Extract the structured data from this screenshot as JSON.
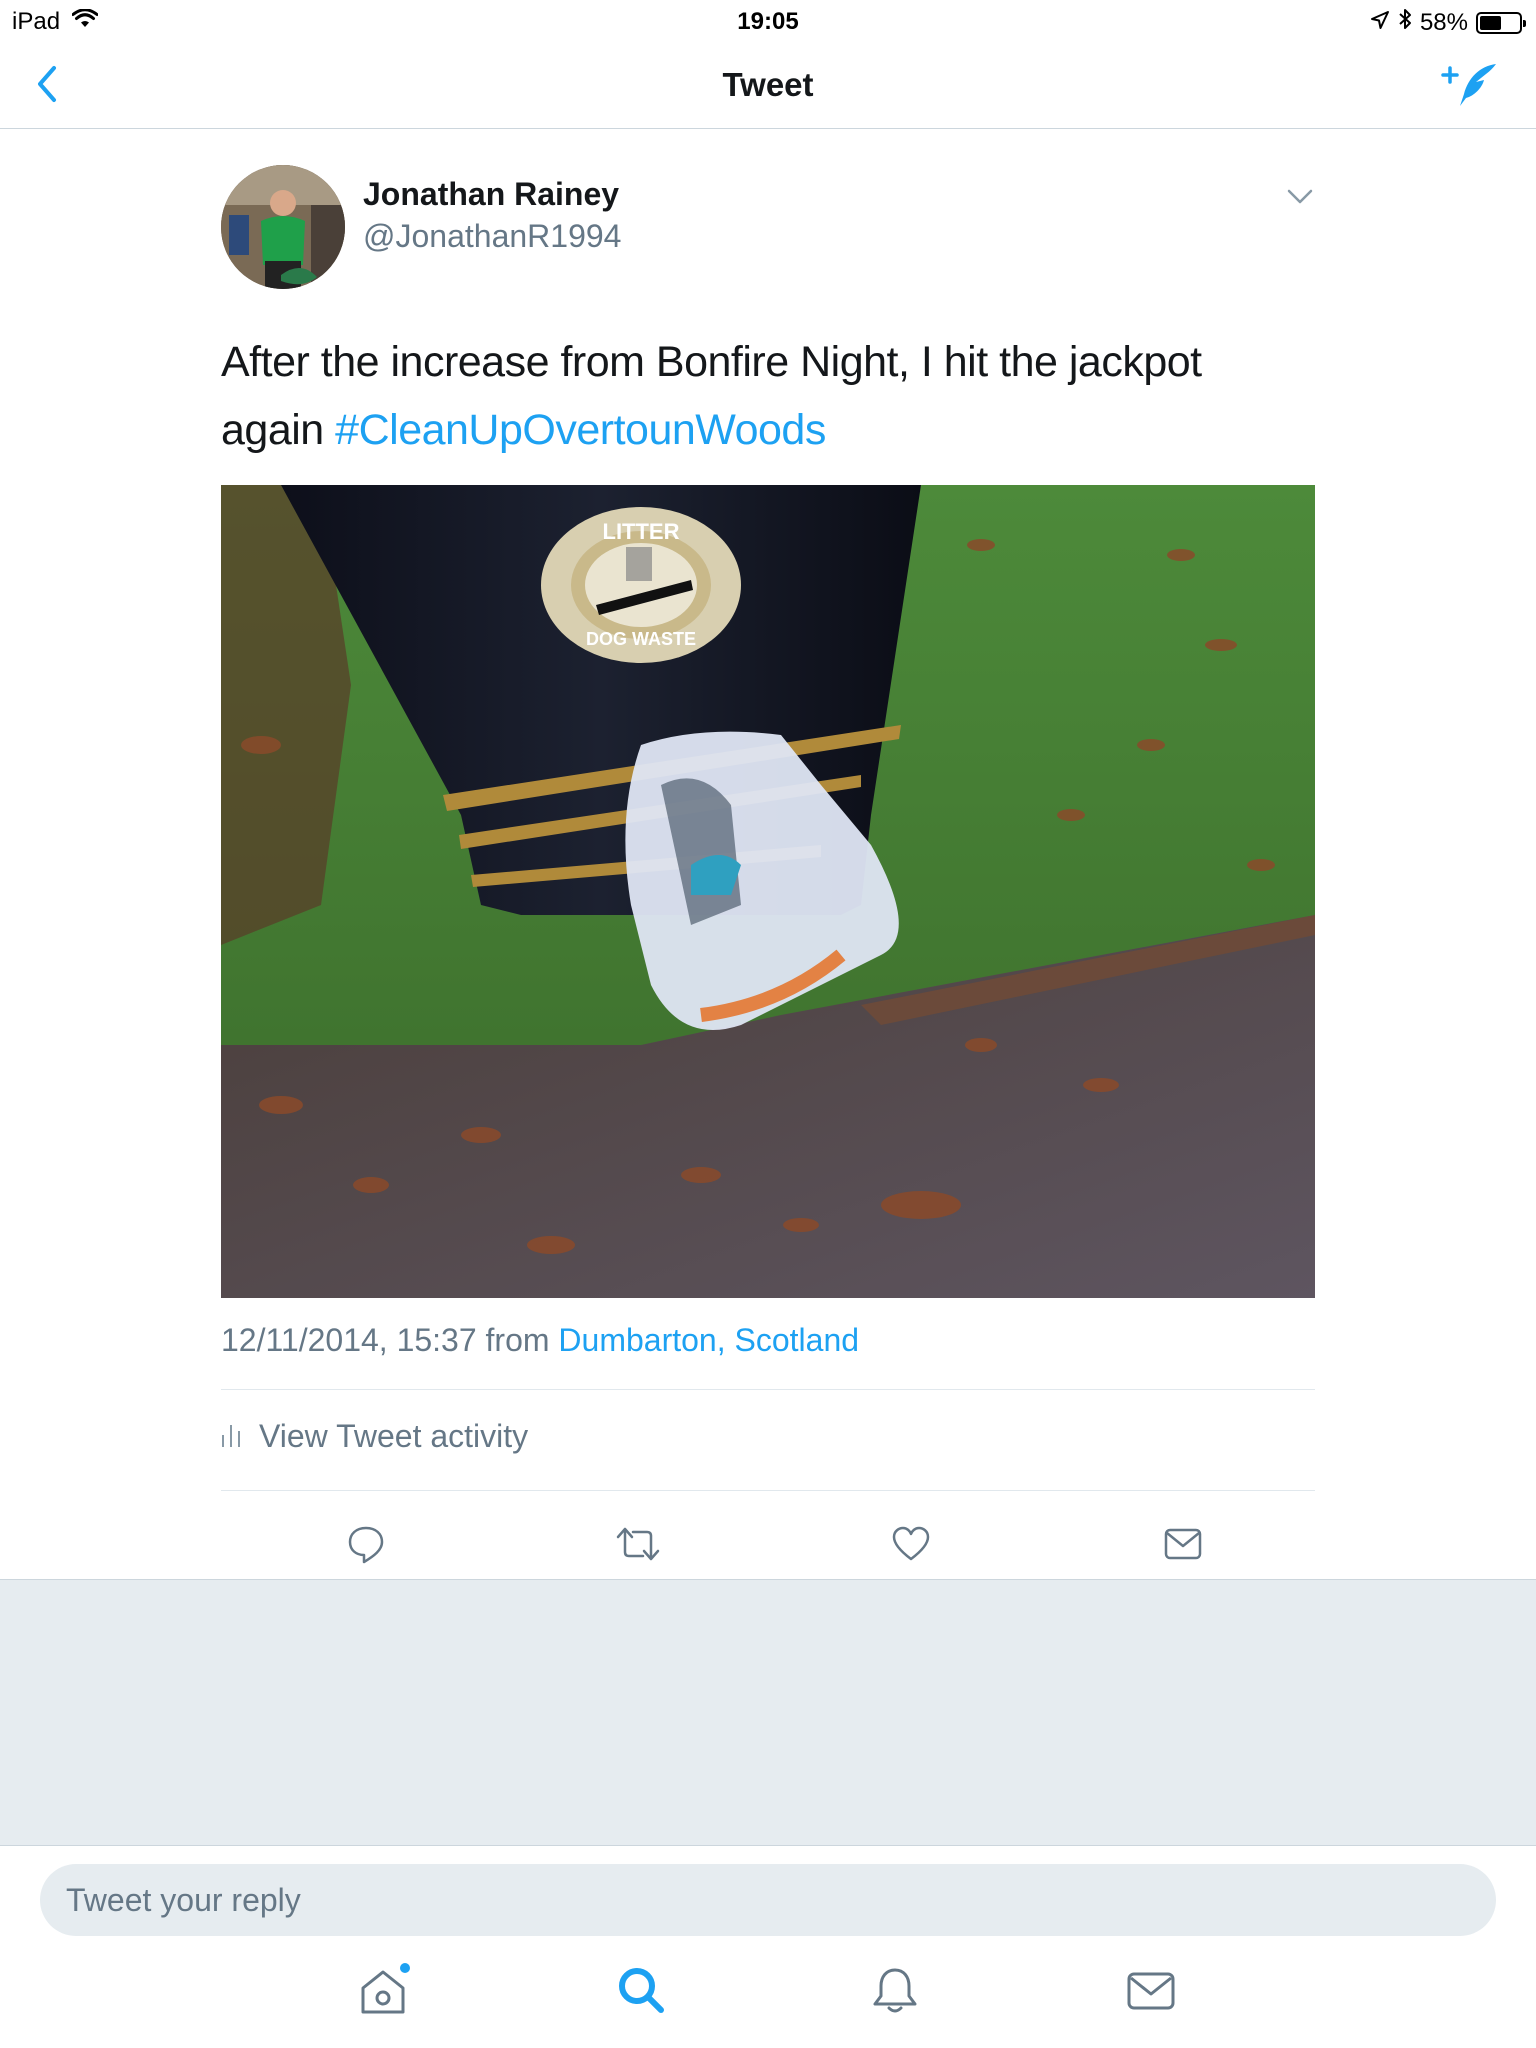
{
  "status_bar": {
    "device": "iPad",
    "time": "19:05",
    "battery_percent": "58%",
    "battery_level": 0.58,
    "icons": [
      "wifi-icon",
      "location-arrow-icon",
      "bluetooth-icon",
      "battery-icon"
    ]
  },
  "nav": {
    "title": "Tweet",
    "back_icon": "chevron-left-icon",
    "compose_icon": "compose-tweet-icon"
  },
  "tweet": {
    "author_name": "Jonathan Rainey",
    "author_handle": "@JonathanR1994",
    "text": "After the increase from Bonfire Night, I hit the jackpot again ",
    "hashtag": "#CleanUpOvertounWoods",
    "photo_text": {
      "bin_top": "LITTER",
      "bin_bottom": "DOG WASTE"
    },
    "timestamp_prefix": "12/11/2014, 15:37 from ",
    "location": "Dumbarton, Scotland",
    "activity_label": "View Tweet activity",
    "actions": [
      "reply-icon",
      "retweet-icon",
      "like-icon",
      "direct-message-icon"
    ]
  },
  "reply": {
    "placeholder": "Tweet your reply"
  },
  "tabbar": {
    "tabs": [
      "home-icon",
      "search-icon",
      "notifications-icon",
      "messages-icon"
    ],
    "active": "search-icon",
    "home_has_badge": true
  },
  "colors": {
    "accent": "#1da1f2",
    "secondary_text": "#657786",
    "background_grey": "#e6ecf0",
    "divider": "#e1e8ed"
  }
}
